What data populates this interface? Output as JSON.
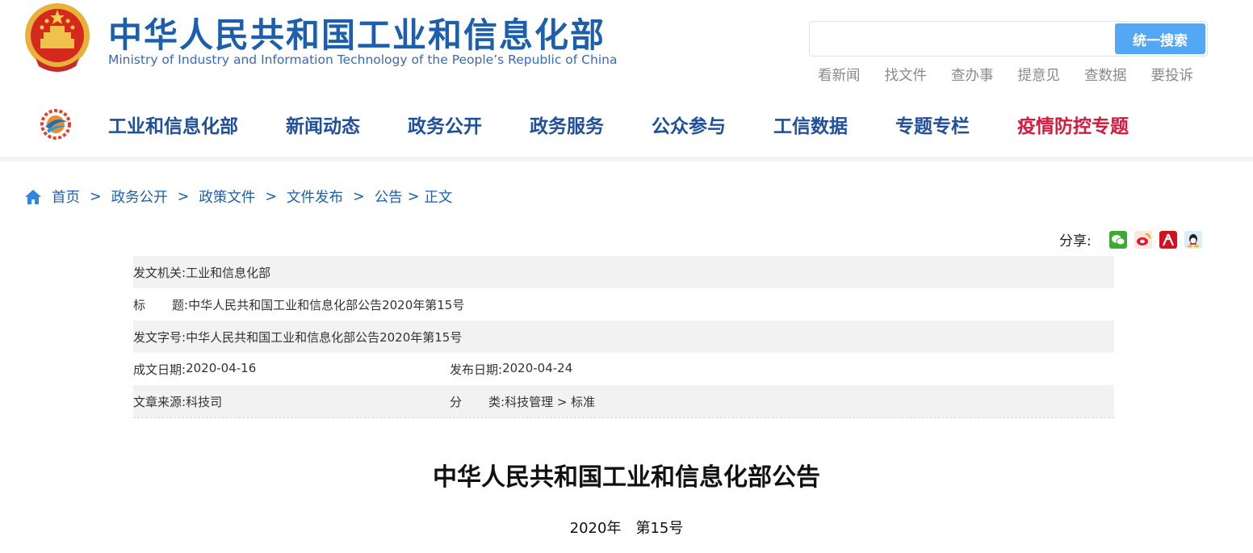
{
  "header": {
    "title": "中华人民共和国工业和信息化部",
    "subtitle": "Ministry of Industry and Information Technology of the People’s Republic of China",
    "emblem_icon": "national-emblem-icon"
  },
  "search": {
    "value": "",
    "button_label": "统一搜索"
  },
  "quick_links": [
    "看新闻",
    "找文件",
    "查办事",
    "提意见",
    "查数据",
    "要投诉"
  ],
  "nav": {
    "logo_icon": "miit-logo-icon",
    "items": [
      "工业和信息化部",
      "新闻动态",
      "政务公开",
      "政务服务",
      "公众参与",
      "工信数据",
      "专题专栏",
      "疫情防控专题"
    ]
  },
  "breadcrumb": {
    "items": [
      "首页",
      "政务公开",
      "政策文件",
      "文件发布",
      "公告"
    ],
    "current": "正文"
  },
  "share": {
    "label": "分享:",
    "icons": [
      "wechat-icon",
      "weibo-icon",
      "renren-icon",
      "qq-icon"
    ]
  },
  "info": {
    "issuer_label": "发文机关:",
    "issuer": "工业和信息化部",
    "title_label_a": "标",
    "title_label_b": "题:",
    "title": "中华人民共和国工业和信息化部公告2020年第15号",
    "doc_no_label": "发文字号:",
    "doc_no": "中华人民共和国工业和信息化部公告2020年第15号",
    "created_label": "成文日期:",
    "created": "2020-04-16",
    "published_label": "发布日期:",
    "published": "2020-04-24",
    "source_label": "文章来源:",
    "source": "科技司",
    "category_label_a": "分",
    "category_label_b": "类:",
    "category": "科技管理 > 标准"
  },
  "article": {
    "title": "中华人民共和国工业和信息化部公告",
    "subtitle": "2020年　第15号"
  },
  "colors": {
    "brand_blue": "#1d5fad",
    "nav_blue": "#20509b",
    "highlight_red": "#d7193e",
    "search_button": "#53a8f5",
    "row_shade": "#f2f2f2"
  }
}
